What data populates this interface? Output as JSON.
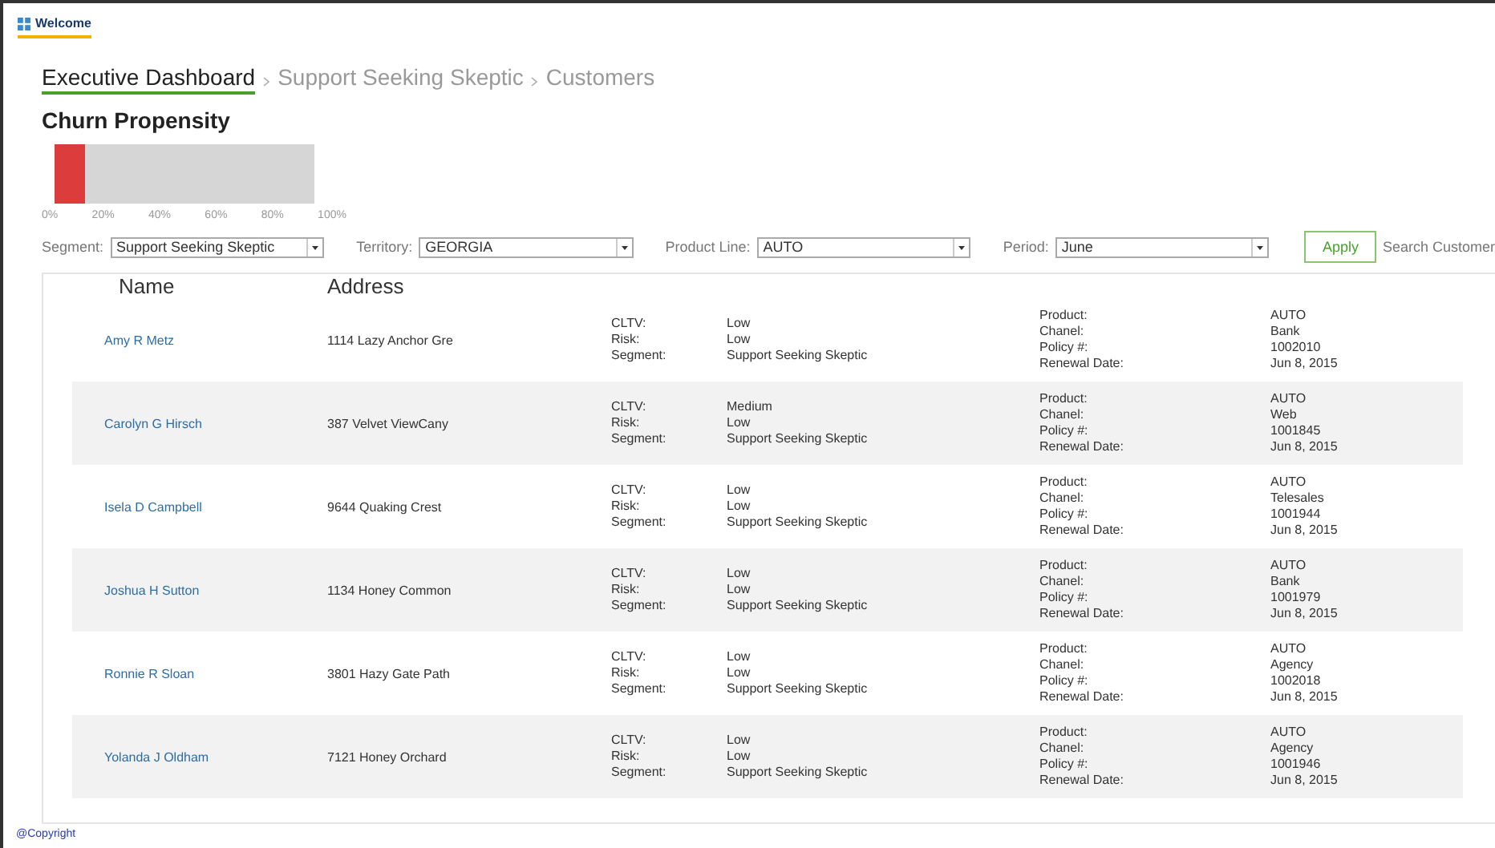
{
  "header": {
    "title": "Welcome"
  },
  "breadcrumb": [
    {
      "label": "Executive Dashboard",
      "selected": true
    },
    {
      "label": "Support Seeking Skeptic",
      "selected": false
    },
    {
      "label": "Customers",
      "selected": false
    }
  ],
  "propensity": {
    "title": "Churn Propensity",
    "level": 0.12,
    "ticks": [
      "0%",
      "20%",
      "40%",
      "60%",
      "80%",
      "100%"
    ]
  },
  "filters": [
    {
      "label": "Segment:",
      "value": "Support Seeking Skeptic"
    },
    {
      "label": "Territory:",
      "value": "GEORGIA"
    },
    {
      "label": "Product Line:",
      "value": "AUTO"
    },
    {
      "label": "Period:",
      "value": "June"
    }
  ],
  "apply_button": "Apply",
  "search_link": "Search Customer",
  "table": {
    "columns": [
      "Name",
      "Address"
    ],
    "rows": [
      {
        "name": "Amy R Metz",
        "address": "1114 Lazy Anchor Gre",
        "scores": [
          [
            "CLTV:",
            "Low"
          ],
          [
            "Risk:",
            "Low"
          ],
          [
            "Segment:",
            "Support Seeking Skeptic"
          ]
        ],
        "policy": [
          [
            "Product:",
            "AUTO"
          ],
          [
            "Chanel:",
            "Bank"
          ],
          [
            "Policy #:",
            "1002010"
          ],
          [
            "Renewal Date:",
            "Jun 8, 2015"
          ]
        ]
      },
      {
        "name": "Carolyn G Hirsch",
        "address": "387 Velvet ViewCany",
        "scores": [
          [
            "CLTV:",
            "Medium"
          ],
          [
            "Risk:",
            "Low"
          ],
          [
            "Segment:",
            "Support Seeking Skeptic"
          ]
        ],
        "policy": [
          [
            "Product:",
            "AUTO"
          ],
          [
            "Chanel:",
            "Web"
          ],
          [
            "Policy #:",
            "1001845"
          ],
          [
            "Renewal Date:",
            "Jun 8, 2015"
          ]
        ]
      },
      {
        "name": "Isela D Campbell",
        "address": "9644 Quaking Crest",
        "scores": [
          [
            "CLTV:",
            "Low"
          ],
          [
            "Risk:",
            "Low"
          ],
          [
            "Segment:",
            "Support Seeking Skeptic"
          ]
        ],
        "policy": [
          [
            "Product:",
            "AUTO"
          ],
          [
            "Chanel:",
            "Telesales"
          ],
          [
            "Policy #:",
            "1001944"
          ],
          [
            "Renewal Date:",
            "Jun 8, 2015"
          ]
        ]
      },
      {
        "name": "Joshua H Sutton",
        "address": "1134 Honey Common",
        "scores": [
          [
            "CLTV:",
            "Low"
          ],
          [
            "Risk:",
            "Low"
          ],
          [
            "Segment:",
            "Support Seeking Skeptic"
          ]
        ],
        "policy": [
          [
            "Product:",
            "AUTO"
          ],
          [
            "Chanel:",
            "Bank"
          ],
          [
            "Policy #:",
            "1001979"
          ],
          [
            "Renewal Date:",
            "Jun 8, 2015"
          ]
        ]
      },
      {
        "name": "Ronnie R Sloan",
        "address": "3801 Hazy Gate Path",
        "scores": [
          [
            "CLTV:",
            "Low"
          ],
          [
            "Risk:",
            "Low"
          ],
          [
            "Segment:",
            "Support Seeking Skeptic"
          ]
        ],
        "policy": [
          [
            "Product:",
            "AUTO"
          ],
          [
            "Chanel:",
            "Agency"
          ],
          [
            "Policy #:",
            "1002018"
          ],
          [
            "Renewal Date:",
            "Jun 8, 2015"
          ]
        ]
      },
      {
        "name": "Yolanda J Oldham",
        "address": "7121 Honey Orchard",
        "scores": [
          [
            "CLTV:",
            "Low"
          ],
          [
            "Risk:",
            "Low"
          ],
          [
            "Segment:",
            "Support Seeking Skeptic"
          ]
        ],
        "policy": [
          [
            "Product:",
            "AUTO"
          ],
          [
            "Chanel:",
            "Agency"
          ],
          [
            "Policy #:",
            "1001946"
          ],
          [
            "Renewal Date:",
            "Jun 8, 2015"
          ]
        ]
      }
    ]
  },
  "footer": "@Copyright"
}
